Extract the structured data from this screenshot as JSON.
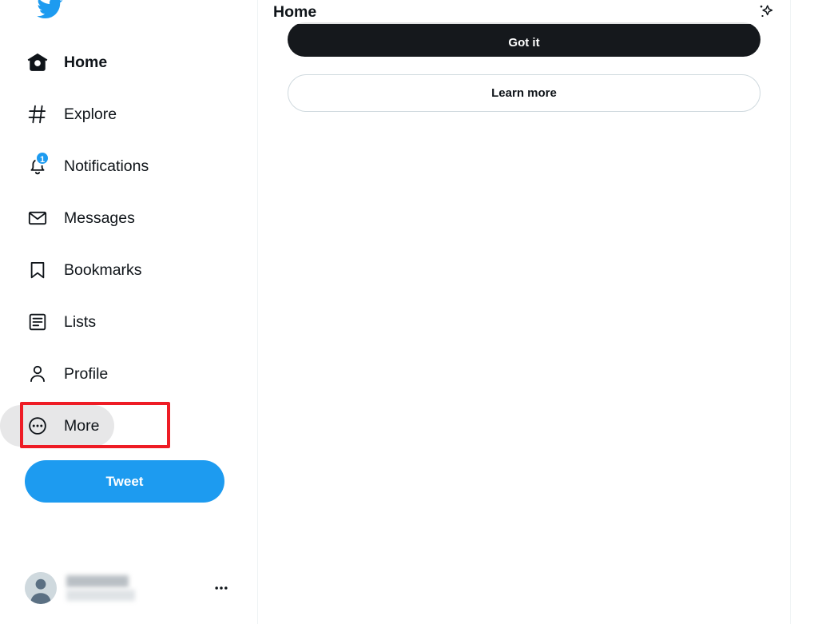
{
  "brand": {
    "logo_icon": "twitter-bird-icon",
    "accent_color": "#1D9BF0",
    "annotation_color": "#EE1C25",
    "dark_button_color": "#15181C"
  },
  "sidebar": {
    "items": [
      {
        "label": "Home",
        "icon": "home-icon",
        "active": true,
        "hovered": false,
        "badge": ""
      },
      {
        "label": "Explore",
        "icon": "hashtag-icon",
        "active": false,
        "hovered": false,
        "badge": ""
      },
      {
        "label": "Notifications",
        "icon": "bell-icon",
        "active": false,
        "hovered": false,
        "badge": "1"
      },
      {
        "label": "Messages",
        "icon": "envelope-icon",
        "active": false,
        "hovered": false,
        "badge": ""
      },
      {
        "label": "Bookmarks",
        "icon": "bookmark-icon",
        "active": false,
        "hovered": false,
        "badge": ""
      },
      {
        "label": "Lists",
        "icon": "list-icon",
        "active": false,
        "hovered": false,
        "badge": ""
      },
      {
        "label": "Profile",
        "icon": "person-icon",
        "active": false,
        "hovered": false,
        "badge": ""
      },
      {
        "label": "More",
        "icon": "circle-ellipsis-icon",
        "active": false,
        "hovered": true,
        "badge": ""
      }
    ],
    "tweet_button_label": "Tweet",
    "account": {
      "avatar_icon": "default-avatar-icon",
      "display_name": "",
      "handle": "",
      "redacted": true,
      "more_icon": "ellipsis-icon"
    }
  },
  "main": {
    "header": {
      "title": "Home",
      "sparkle_icon": "sparkle-icon"
    },
    "prompt": {
      "primary_button_label": "Got it",
      "secondary_button_label": "Learn more"
    }
  }
}
